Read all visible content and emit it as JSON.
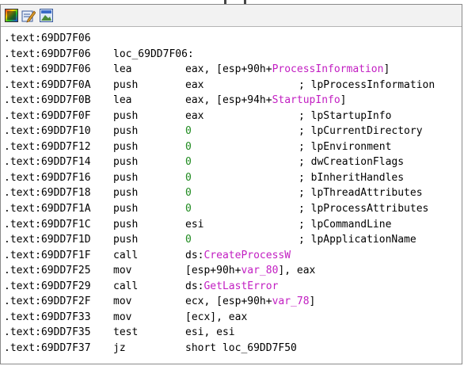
{
  "toolbar": {
    "icons": [
      "graph-view-icon",
      "edit-icon",
      "image-icon"
    ]
  },
  "listing": {
    "lines": [
      {
        "addr": ".text:69DD7F06",
        "mnem": "",
        "ops": [],
        "comment": ""
      },
      {
        "addr": ".text:69DD7F06",
        "label": "loc_69DD7F06:",
        "mnem": "",
        "ops": [],
        "comment": ""
      },
      {
        "addr": ".text:69DD7F06",
        "mnem": "lea",
        "ops": [
          {
            "t": "eax, [esp+90h+"
          },
          {
            "t": "ProcessInformation",
            "c": "ref"
          },
          {
            "t": "]"
          }
        ],
        "comment": ""
      },
      {
        "addr": ".text:69DD7F0A",
        "mnem": "push",
        "ops": [
          {
            "t": "eax"
          }
        ],
        "comment": "; lpProcessInformation"
      },
      {
        "addr": ".text:69DD7F0B",
        "mnem": "lea",
        "ops": [
          {
            "t": "eax, [esp+94h+"
          },
          {
            "t": "StartupInfo",
            "c": "ref"
          },
          {
            "t": "]"
          }
        ],
        "comment": ""
      },
      {
        "addr": ".text:69DD7F0F",
        "mnem": "push",
        "ops": [
          {
            "t": "eax"
          }
        ],
        "comment": "; lpStartupInfo"
      },
      {
        "addr": ".text:69DD7F10",
        "mnem": "push",
        "ops": [
          {
            "t": "0",
            "c": "num"
          }
        ],
        "comment": "; lpCurrentDirectory"
      },
      {
        "addr": ".text:69DD7F12",
        "mnem": "push",
        "ops": [
          {
            "t": "0",
            "c": "num"
          }
        ],
        "comment": "; lpEnvironment"
      },
      {
        "addr": ".text:69DD7F14",
        "mnem": "push",
        "ops": [
          {
            "t": "0",
            "c": "num"
          }
        ],
        "comment": "; dwCreationFlags"
      },
      {
        "addr": ".text:69DD7F16",
        "mnem": "push",
        "ops": [
          {
            "t": "0",
            "c": "num"
          }
        ],
        "comment": "; bInheritHandles"
      },
      {
        "addr": ".text:69DD7F18",
        "mnem": "push",
        "ops": [
          {
            "t": "0",
            "c": "num"
          }
        ],
        "comment": "; lpThreadAttributes"
      },
      {
        "addr": ".text:69DD7F1A",
        "mnem": "push",
        "ops": [
          {
            "t": "0",
            "c": "num"
          }
        ],
        "comment": "; lpProcessAttributes"
      },
      {
        "addr": ".text:69DD7F1C",
        "mnem": "push",
        "ops": [
          {
            "t": "esi"
          }
        ],
        "comment": "; lpCommandLine"
      },
      {
        "addr": ".text:69DD7F1D",
        "mnem": "push",
        "ops": [
          {
            "t": "0",
            "c": "num"
          }
        ],
        "comment": "; lpApplicationName"
      },
      {
        "addr": ".text:69DD7F1F",
        "mnem": "call",
        "ops": [
          {
            "t": "ds:"
          },
          {
            "t": "CreateProcessW",
            "c": "ref"
          }
        ],
        "comment": ""
      },
      {
        "addr": ".text:69DD7F25",
        "mnem": "mov",
        "ops": [
          {
            "t": "[esp+90h+"
          },
          {
            "t": "var_80",
            "c": "ref"
          },
          {
            "t": "], eax"
          }
        ],
        "comment": ""
      },
      {
        "addr": ".text:69DD7F29",
        "mnem": "call",
        "ops": [
          {
            "t": "ds:"
          },
          {
            "t": "GetLastError",
            "c": "ref"
          }
        ],
        "comment": ""
      },
      {
        "addr": ".text:69DD7F2F",
        "mnem": "mov",
        "ops": [
          {
            "t": "ecx, [esp+90h+"
          },
          {
            "t": "var_78",
            "c": "ref"
          },
          {
            "t": "]"
          }
        ],
        "comment": ""
      },
      {
        "addr": ".text:69DD7F33",
        "mnem": "mov",
        "ops": [
          {
            "t": "[ecx], eax"
          }
        ],
        "comment": ""
      },
      {
        "addr": ".text:69DD7F35",
        "mnem": "test",
        "ops": [
          {
            "t": "esi, esi"
          }
        ],
        "comment": ""
      },
      {
        "addr": ".text:69DD7F37",
        "mnem": "jz",
        "ops": [
          {
            "t": "short loc_69DD7F50"
          }
        ],
        "comment": ""
      }
    ]
  },
  "colors": {
    "immediate": "#1e8a1e",
    "reference": "#c21ec2",
    "text": "#000000"
  }
}
